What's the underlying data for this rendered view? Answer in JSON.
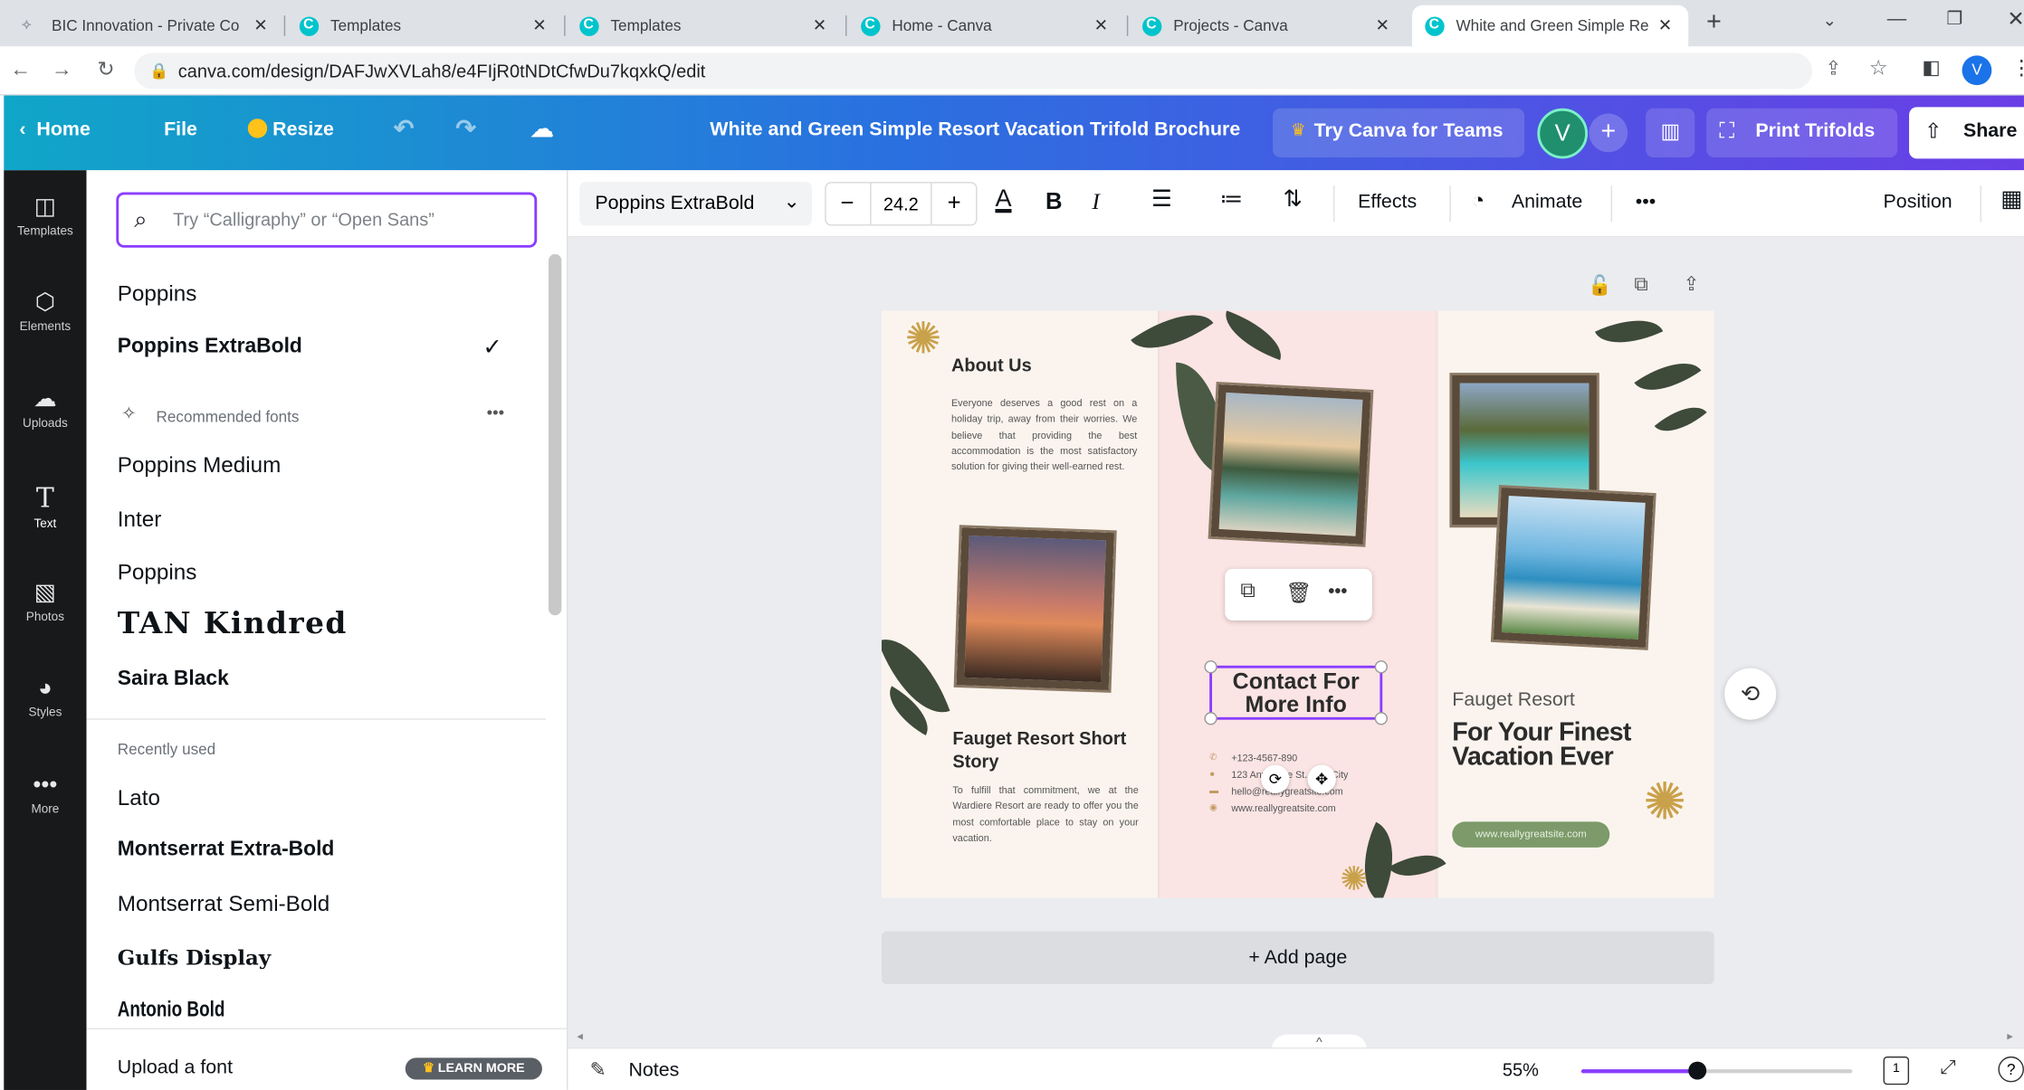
{
  "browser": {
    "tabs": [
      {
        "label": "BIC Innovation - Private Co"
      },
      {
        "label": "Templates"
      },
      {
        "label": "Templates"
      },
      {
        "label": "Home - Canva"
      },
      {
        "label": "Projects - Canva"
      },
      {
        "label": "White and Green Simple Re"
      }
    ],
    "url": "canva.com/design/DAFJwXVLah8/e4FIjR0tNDtCfwDu7kqxkQ/edit",
    "profile_initial": "V"
  },
  "header": {
    "home": "Home",
    "file": "File",
    "resize": "Resize",
    "doc_title": "White and Green Simple Resort Vacation Trifold Brochure",
    "try_teams": "Try Canva for Teams",
    "avatar_initial": "V",
    "print": "Print Trifolds",
    "share": "Share"
  },
  "rail": [
    {
      "label": "Templates",
      "icon": "layout-icon"
    },
    {
      "label": "Elements",
      "icon": "shapes-icon"
    },
    {
      "label": "Uploads",
      "icon": "cloud-upload-icon"
    },
    {
      "label": "Text",
      "icon": "text-icon"
    },
    {
      "label": "Photos",
      "icon": "image-icon"
    },
    {
      "label": "Styles",
      "icon": "palette-icon"
    },
    {
      "label": "More",
      "icon": "more-icon"
    }
  ],
  "font_panel": {
    "search_placeholder": "Try “Calligraphy” or “Open Sans”",
    "current": [
      "Poppins",
      "Poppins ExtraBold"
    ],
    "recommended_heading": "Recommended fonts",
    "recommended": [
      "Poppins Medium",
      "Inter",
      "Poppins",
      "TAN Kindred",
      "Saira Black"
    ],
    "recent_heading": "Recently used",
    "recent": [
      "Lato",
      "Montserrat Extra-Bold",
      "Montserrat Semi-Bold",
      "Gulfs Display",
      "Antonio Bold"
    ],
    "upload": "Upload a font",
    "learn_more": "LEARN MORE"
  },
  "toolbar": {
    "font": "Poppins ExtraBold",
    "size": "24.2",
    "effects": "Effects",
    "animate": "Animate",
    "position": "Position"
  },
  "brochure": {
    "about_title": "About Us",
    "about_body": "Everyone deserves a good rest on a holiday trip, away from their worries. We believe that providing the best accommodation is the most satisfactory solution for giving their well-earned rest.",
    "story_title": "Fauget Resort Short Story",
    "story_body": "To fulfill that commitment, we at the Wardiere Resort are ready to offer you the most comfortable place to stay on your vacation.",
    "contact_title": "Contact For More Info",
    "contact_lines": [
      "+123-4567-890",
      "123 Anywhere St., Any City",
      "hello@reallygreatsite.com",
      "www.reallygreatsite.com"
    ],
    "resort_name": "Fauget Resort",
    "tagline": "For Your Finest Vacation Ever",
    "website_pill": "www.reallygreatsite.com"
  },
  "add_page": "+ Add page",
  "status": {
    "notes": "Notes",
    "zoom": "55%",
    "page_num": "1"
  },
  "colors": {
    "accent": "#8b3dff",
    "leaf": "#3e4a3a",
    "pink_panel": "#fbe6e6",
    "pill": "#7c9a6a"
  }
}
